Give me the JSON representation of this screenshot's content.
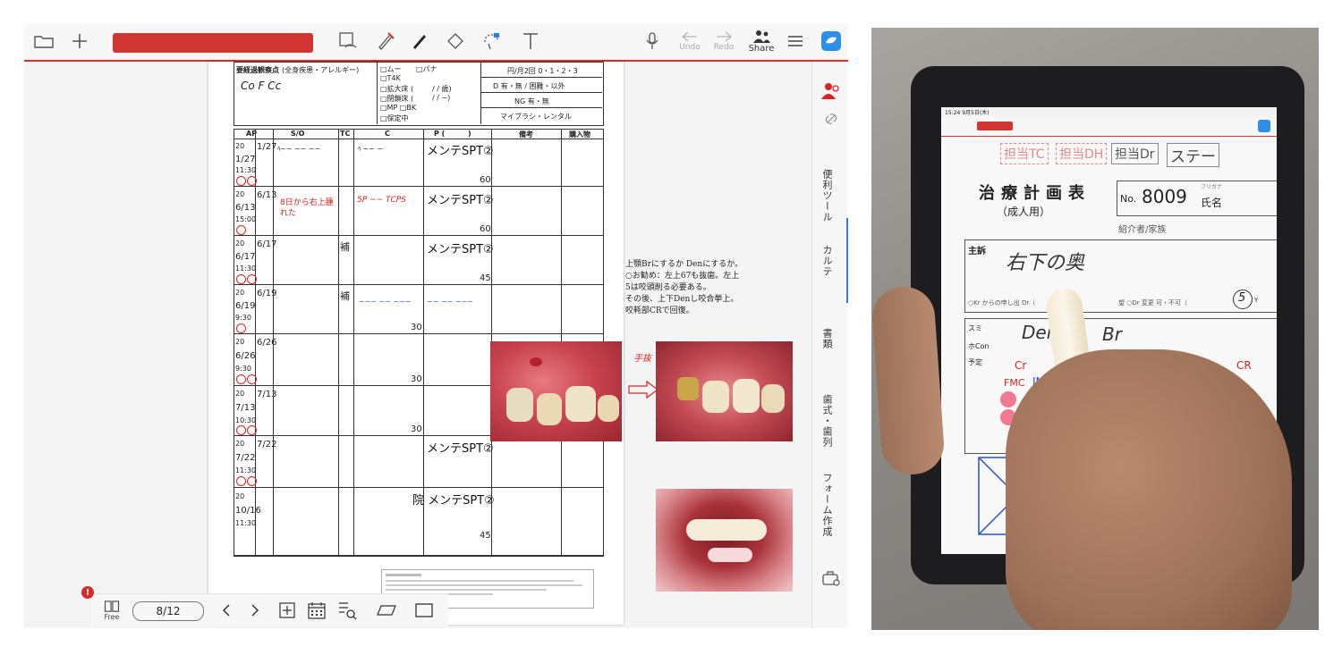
{
  "toolbar": {
    "undo_label": "Undo",
    "redo_label": "Redo",
    "share_label": "Share"
  },
  "side_tabs": [
    "便利ツール",
    "カルテ",
    "書類",
    "歯式・歯列",
    "フォーム作成"
  ],
  "bottom": {
    "page_counter": "8/12",
    "free_label": "Free",
    "notification_badge": "!"
  },
  "chart_header": {
    "title": "要経過観察点",
    "title_sub": "(全身疾患・アレルギー)",
    "handwriting": "Co F Cc",
    "options_col1": [
      "□ムー",
      "□T4K",
      "□拡大床 (",
      "□閉鎖床 (",
      "□MP □BK",
      "□保定中"
    ],
    "options_col2": [
      "□パナ",
      "/ / 歳)",
      "/ / ~)"
    ],
    "recall": "円/月2回 0・1・2・3",
    "d_line": "D 有・無 / 困難・以外",
    "ng_line": "NG 有・無",
    "brush": "マイブラシ・レンタル"
  },
  "table": {
    "headers": [
      "AP",
      "S/O",
      "TC",
      "C",
      "P (",
      ")",
      "備考",
      "購入物"
    ],
    "rows": [
      {
        "year": "20",
        "date": "1/27",
        "date2": "1/27",
        "time": "11:30",
        "p_text": "メンテSPT②",
        "num": "60"
      },
      {
        "year": "20",
        "date": "6/13",
        "date2": "6/13",
        "time": "15:00",
        "p_text": "メンテSPT②",
        "num": "60",
        "note": "8日から右上腫れた"
      },
      {
        "year": "20",
        "date": "6/17",
        "date2": "6/17",
        "time": "11:30",
        "p_text": "メンテSPT②",
        "num": "45",
        "tc": "補"
      },
      {
        "year": "20",
        "date": "6/19",
        "date2": "6/19",
        "time": "9:30",
        "num": "30",
        "tc": "補"
      },
      {
        "year": "20",
        "date": "6/26",
        "date2": "6/26",
        "time": "9:30",
        "num": "30"
      },
      {
        "year": "20",
        "date": "7/13",
        "date2": "7/13",
        "time": "10:30",
        "num": "30"
      },
      {
        "year": "20",
        "date": "7/22",
        "date2": "7/22",
        "time": "11:30",
        "p_text": "メンテSPT②"
      },
      {
        "year": "20",
        "date": "",
        "date2": "10/16",
        "time": "11:30",
        "p_text": "院 メンテSPT②",
        "num": "45"
      }
    ]
  },
  "side_note": {
    "lines": [
      "上顎Brにするか Denにするか。",
      "○お勧め：左上67も抜歯。左上",
      "5は咬頭削る必要ある。",
      "その後、上下Denし咬合挙上。",
      "咬耗部CRで回復。"
    ]
  },
  "photo_caption": "手抜",
  "ipad_screen": {
    "status_time": "15:24 9月5日(木)",
    "title": "治療計画表",
    "subtitle": "（成人用）",
    "no_label": "No.",
    "no_value": "8009",
    "name_label": "氏名",
    "furigana": "フリガナ",
    "referrer": "紹介者/家族",
    "complaint_label": "主訴",
    "complaint_handwriting": "右下の奥",
    "stamps": [
      "担当TC",
      "担当DH",
      "担当Dr",
      "ステー"
    ],
    "consent_line": "○Kr からの申し出 Dr（",
    "consent_line2": "望 ○Dr 変更 可・不可（",
    "circled": "5",
    "circled_unit": "Y",
    "row_labels": [
      "スミ",
      "ホCon",
      "予定"
    ],
    "handwriting_plan": [
      "Den",
      "Br",
      "Cr",
      "FMC",
      "IN",
      "CR"
    ]
  },
  "colors": {
    "accent_red": "#d23633",
    "rail_active": "#2f7fe0",
    "handwriting_red": "#d22222",
    "handwriting_blue": "#2a4fd6"
  }
}
